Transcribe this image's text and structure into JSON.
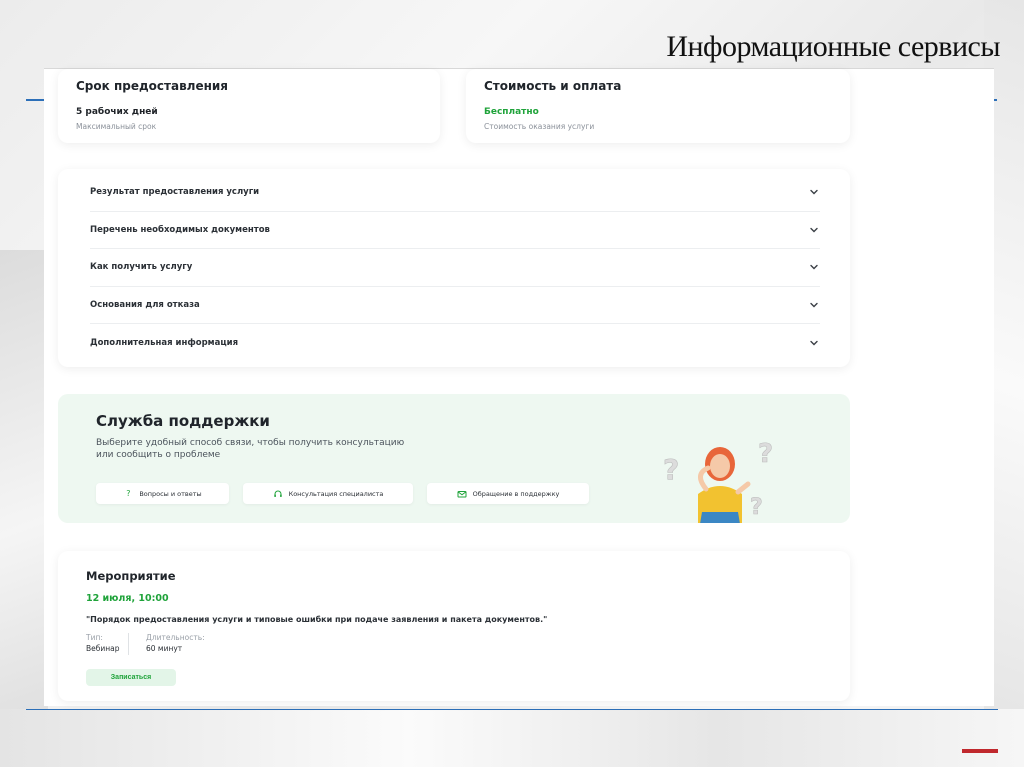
{
  "slide": {
    "title": "Информационные сервисы"
  },
  "term_card": {
    "title": "Срок предоставления",
    "value": "5 рабочих дней",
    "caption": "Максимальный срок"
  },
  "cost_card": {
    "title": "Стоимость и оплата",
    "value": "Бесплатно",
    "caption": "Стоимость оказания услуги"
  },
  "accordion": {
    "items": [
      {
        "label": "Результат предоставления услуги"
      },
      {
        "label": "Перечень необходимых документов"
      },
      {
        "label": "Как получить услугу"
      },
      {
        "label": "Основания для отказа"
      },
      {
        "label": "Дополнительная информация"
      }
    ]
  },
  "support": {
    "title": "Служба поддержки",
    "description": "Выберите удобный способ связи, чтобы получить консультацию или сообщить о проблеме",
    "buttons": {
      "faq": {
        "icon": "?",
        "label": "Вопросы и ответы"
      },
      "consult": {
        "label": "Консультация специалиста"
      },
      "appeal": {
        "label": "Обращение в поддержку"
      }
    }
  },
  "event": {
    "title": "Мероприятие",
    "date": "12 июля, 10:00",
    "topic": "\"Порядок предоставления услуги и типовые ошибки при подаче заявления и пакета документов.\"",
    "type_label": "Тип:",
    "type_value": "Вебинар",
    "duration_label": "Длительность:",
    "duration_value": "60 минут",
    "signup_label": "Записаться"
  },
  "colors": {
    "accent_green": "#1fa33a",
    "support_bg": "#eef8f1",
    "rule_blue": "#2c6fb8",
    "mark_red": "#c0282d"
  },
  "icons": {
    "chevron": "chevron-down-icon",
    "faq": "question-icon",
    "consult": "headset-icon",
    "appeal": "mail-icon"
  }
}
